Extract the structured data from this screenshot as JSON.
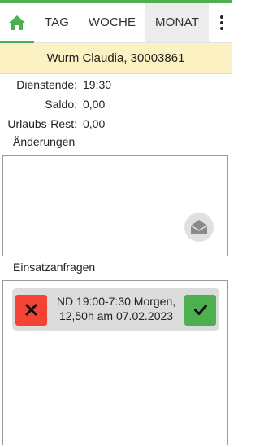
{
  "nav": {
    "home_icon": "home-icon",
    "tabs": [
      {
        "label": "TAG"
      },
      {
        "label": "WOCHE"
      },
      {
        "label": "MONAT"
      }
    ],
    "more_icon": "more-vertical-icon",
    "active_color": "#4caf50"
  },
  "user": {
    "name_line": "Wurm Claudia, 30003861"
  },
  "summary": {
    "service_label": "Dienstende:",
    "service_value": "19:30",
    "balance_label": "Saldo:",
    "balance_value": "0,00",
    "vacation_label": "Urlaubs-Rest:",
    "vacation_value": "0,00"
  },
  "changes": {
    "title": "Änderungen",
    "mail_icon": "envelope-open-icon"
  },
  "requests": {
    "title": "Einsatzanfragen",
    "items": [
      {
        "text": "ND 19:00-7:30 Morgen, 12,50h am 07.02.2023",
        "reject_icon": "close-icon",
        "accept_icon": "check-icon"
      }
    ]
  },
  "colors": {
    "accent": "#4caf50",
    "reject": "#f44336",
    "user_bar": "#fbf1c2"
  }
}
